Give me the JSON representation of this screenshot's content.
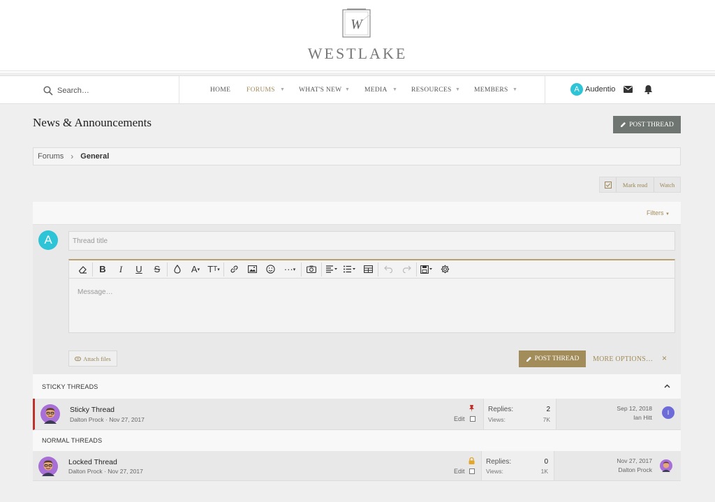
{
  "brand": {
    "name": "WESTLAKE",
    "logo_letter": "W"
  },
  "search": {
    "placeholder": "Search…"
  },
  "nav": {
    "items": [
      {
        "label": "HOME"
      },
      {
        "label": "FORUMS",
        "active": true
      },
      {
        "label": "WHAT'S NEW"
      },
      {
        "label": "MEDIA"
      },
      {
        "label": "RESOURCES"
      },
      {
        "label": "MEMBERS"
      }
    ],
    "user": {
      "name": "Audentio",
      "initial": "A"
    }
  },
  "page": {
    "title": "News & Announcements",
    "post_thread_label": "POST THREAD"
  },
  "breadcrumb": {
    "parent": "Forums",
    "current": "General"
  },
  "actions": {
    "mark_read": "Mark read",
    "watch": "Watch"
  },
  "filters": {
    "label": "Filters"
  },
  "composer": {
    "avatar_initial": "A",
    "title_placeholder": "Thread title",
    "message_placeholder": "Message…",
    "attach_label": "Attach files",
    "post_label": "POST THREAD",
    "more_options": "MORE OPTIONS…",
    "close_icon": "×"
  },
  "sections": {
    "sticky": "STICKY THREADS",
    "normal": "NORMAL THREADS"
  },
  "threads": {
    "sticky": {
      "title": "Sticky Thread",
      "author": "Dalton Prock",
      "date": "Nov 27, 2017",
      "edit": "Edit",
      "replies_label": "Replies:",
      "replies": "2",
      "views_label": "Views:",
      "views": "7K",
      "last_date": "Sep 12, 2018",
      "last_user": "Ian Hitt",
      "last_initial": "I"
    },
    "locked": {
      "title": "Locked Thread",
      "author": "Dalton Prock",
      "date": "Nov 27, 2017",
      "edit": "Edit",
      "replies_label": "Replies:",
      "replies": "0",
      "views_label": "Views:",
      "views": "1K",
      "last_date": "Nov 27, 2017",
      "last_user": "Dalton Prock"
    }
  },
  "colors": {
    "accent_gold": "#a28c5a",
    "teal": "#2cc4d6",
    "sticky_marker": "#c0302a",
    "lock_icon": "#e2a62b"
  }
}
